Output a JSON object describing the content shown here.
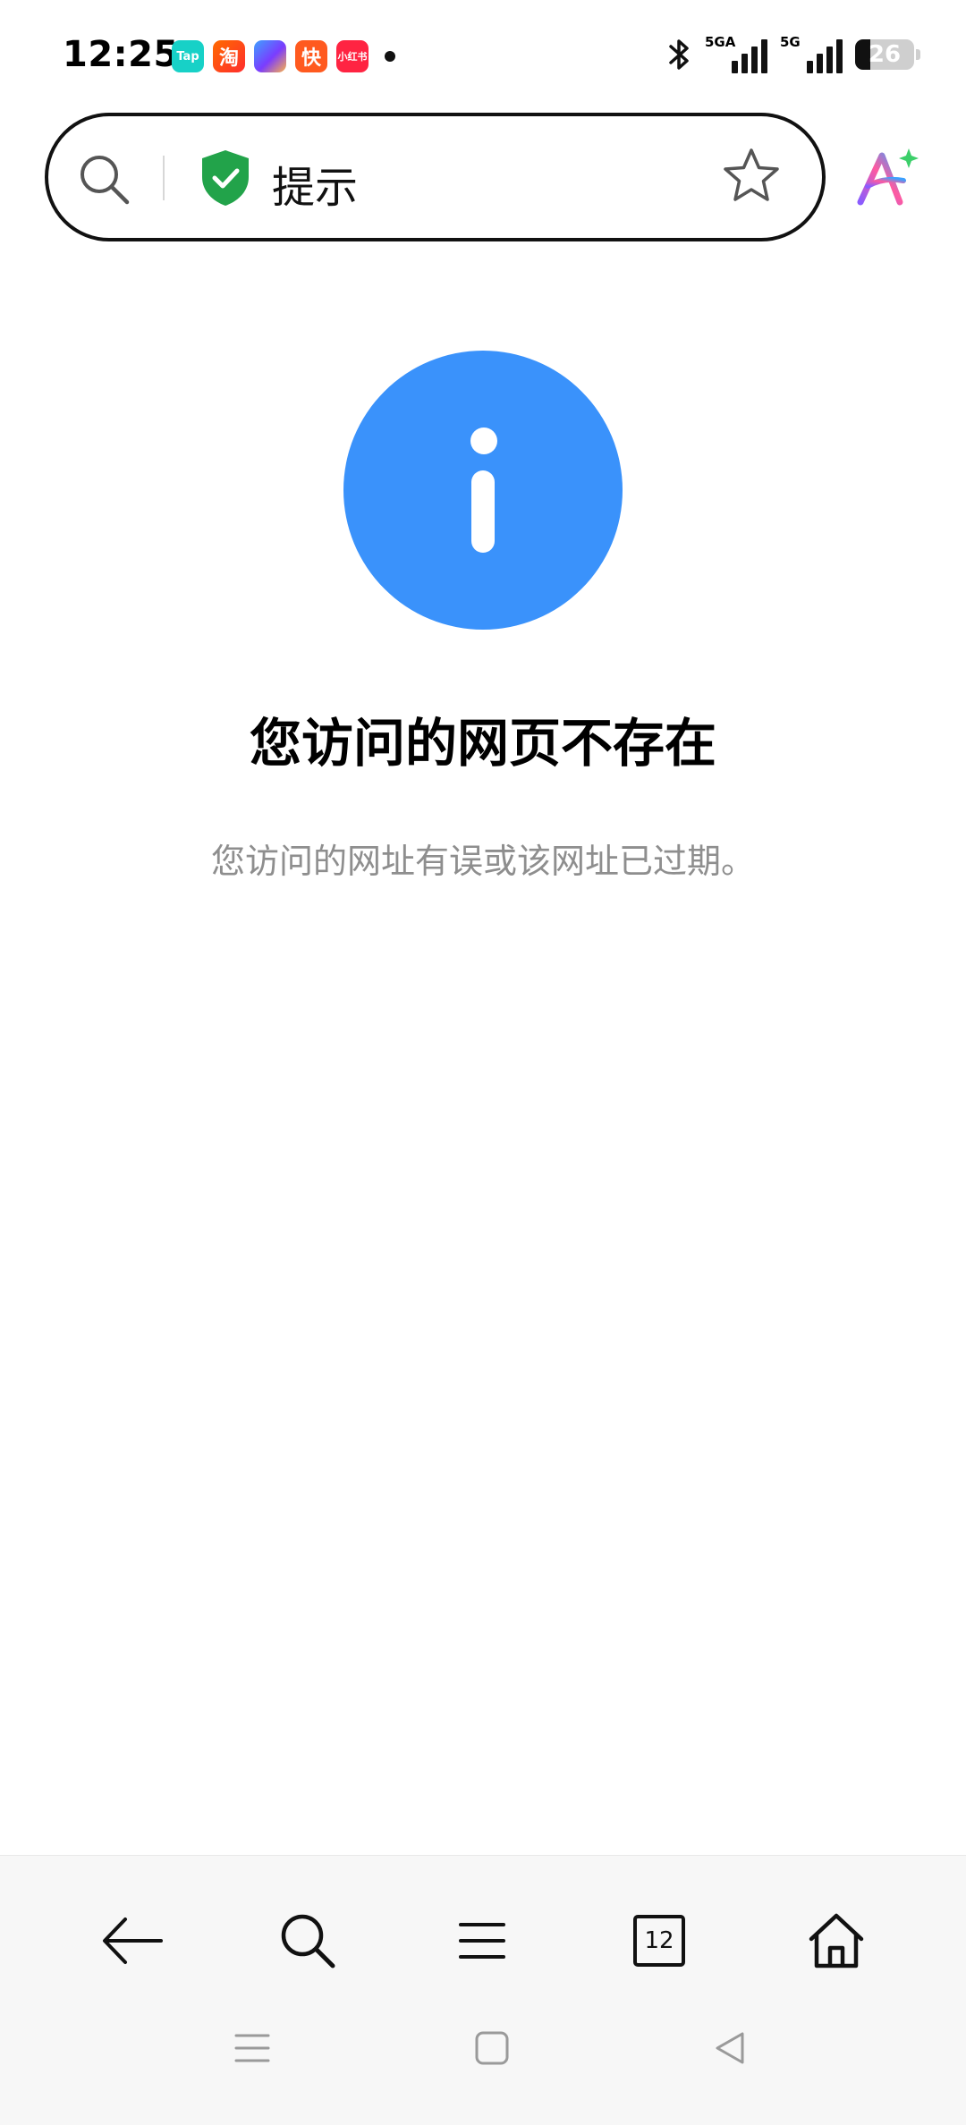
{
  "status_bar": {
    "time": "12:25",
    "notification_apps": [
      "tap-app-icon",
      "taobao-app-icon",
      "game-app-icon",
      "kuaishou-app-icon",
      "xiaohongshu-app-icon"
    ],
    "tap_label": "Tap",
    "taobao_label": "淘",
    "kuaishou_label": "快",
    "xhs_label": "小红书",
    "signal_1_label": "5GA",
    "signal_2_label": "5G",
    "battery_level": "26"
  },
  "address_bar": {
    "title": "提示"
  },
  "error_page": {
    "title": "您访问的网页不存在",
    "description": "您访问的网址有误或该网址已过期。"
  },
  "toolbar": {
    "tab_count": "12"
  },
  "colors": {
    "accent": "#3a92fb",
    "shield_green": "#22a34a",
    "description_gray": "#8e8e8e"
  }
}
